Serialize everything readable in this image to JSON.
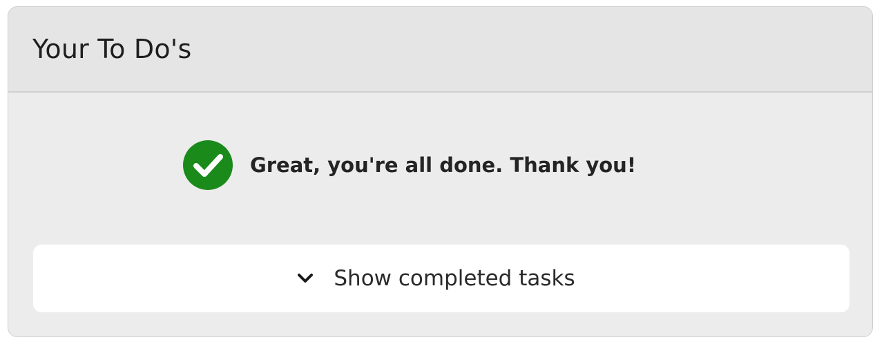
{
  "card": {
    "title": "Your To Do's"
  },
  "status": {
    "icon": "check-circle-icon",
    "message": "Great, you're all done. Thank you!",
    "color": "#1a8a1a"
  },
  "completed_toggle": {
    "icon": "chevron-down-icon",
    "label": "Show completed tasks"
  }
}
